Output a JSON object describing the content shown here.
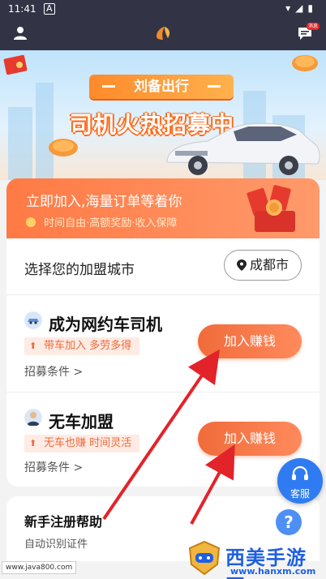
{
  "status": {
    "time": "11:41",
    "app_icon": "A",
    "system_icons": "▾◢▮"
  },
  "topbar": {
    "user_icon": "user-icon",
    "logo_icon": "brand-logo-icon",
    "message_icon": "message-icon",
    "message_badge": "消息"
  },
  "banner": {
    "brand": "刘备出行",
    "headline": "司机火热招募中"
  },
  "hero": {
    "title": "立即加入,海量订单等着你",
    "subtitle": "时间自由·高额奖励·收入保障"
  },
  "city": {
    "label": "选择您的加盟城市",
    "value": "成都市"
  },
  "options": [
    {
      "title": "成为网约车司机",
      "tag": "带车加入 多劳多得",
      "condition": "招募条件 >",
      "button": "加入赚钱"
    },
    {
      "title": "无车加盟",
      "tag": "无车也赚 时间灵活",
      "condition": "招募条件 >",
      "button": "加入赚钱"
    }
  ],
  "help": {
    "title": "新手注册帮助",
    "subtitle": "自动识别证件"
  },
  "service": {
    "label": "客服"
  },
  "watermarks": {
    "left": "www.java800.com",
    "right_main": "西美手游网",
    "right_sub": "www.hanxm.com"
  },
  "colors": {
    "accent": "#f06b3a",
    "topbar": "#323446",
    "service": "#2f7bf2",
    "watermark_blue": "#1f5fe0"
  }
}
